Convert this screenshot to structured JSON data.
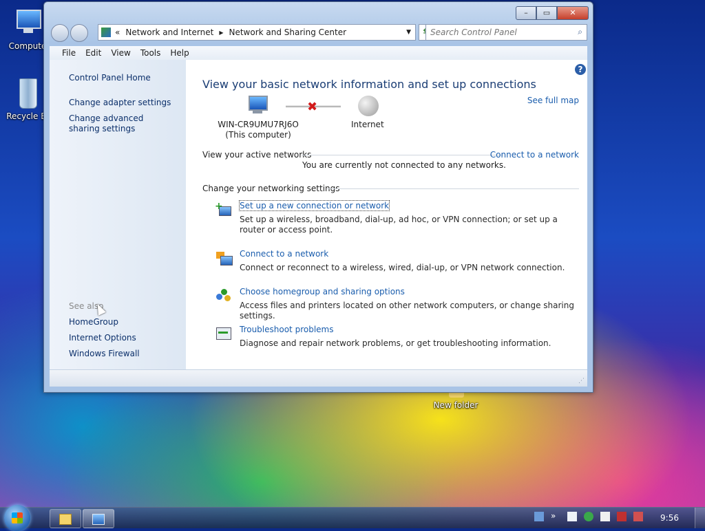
{
  "desktop": {
    "icons": [
      {
        "label": "Compute"
      },
      {
        "label": "Recycle Bi"
      },
      {
        "label": "New folder"
      }
    ]
  },
  "window": {
    "controls": {
      "minimize": "–",
      "maximize": "▭",
      "close": "✕"
    },
    "address": {
      "crumb_prefix": "«",
      "crumbs": [
        "Network and Internet",
        "Network and Sharing Center"
      ]
    },
    "search": {
      "placeholder": "Search Control Panel"
    },
    "menu": [
      "File",
      "Edit",
      "View",
      "Tools",
      "Help"
    ]
  },
  "left_pane": {
    "links": [
      "Control Panel Home",
      "Change adapter settings",
      "Change advanced sharing settings"
    ],
    "see_also_label": "See also",
    "see_also_links": [
      "HomeGroup",
      "Internet Options",
      "Windows Firewall"
    ]
  },
  "main": {
    "title": "View your basic network information and set up connections",
    "see_full_map": "See full map",
    "computer_name": "WIN-CR9UMU7RJ6O",
    "computer_sub": "(This computer)",
    "internet_label": "Internet",
    "active_networks_header": "View your active networks",
    "connect_link": "Connect to a network",
    "not_connected_msg": "You are currently not connected to any networks.",
    "settings_header": "Change your networking settings",
    "tasks": [
      {
        "link": "Set up a new connection or network",
        "desc": "Set up a wireless, broadband, dial-up, ad hoc, or VPN connection; or set up a router or access point."
      },
      {
        "link": "Connect to a network",
        "desc": "Connect or reconnect to a wireless, wired, dial-up, or VPN network connection."
      },
      {
        "link": "Choose homegroup and sharing options",
        "desc": "Access files and printers located on other network computers, or change sharing settings."
      },
      {
        "link": "Troubleshoot problems",
        "desc": "Diagnose and repair network problems, or get troubleshooting information."
      }
    ]
  },
  "taskbar": {
    "clock": "9:56",
    "overflow": "»"
  }
}
